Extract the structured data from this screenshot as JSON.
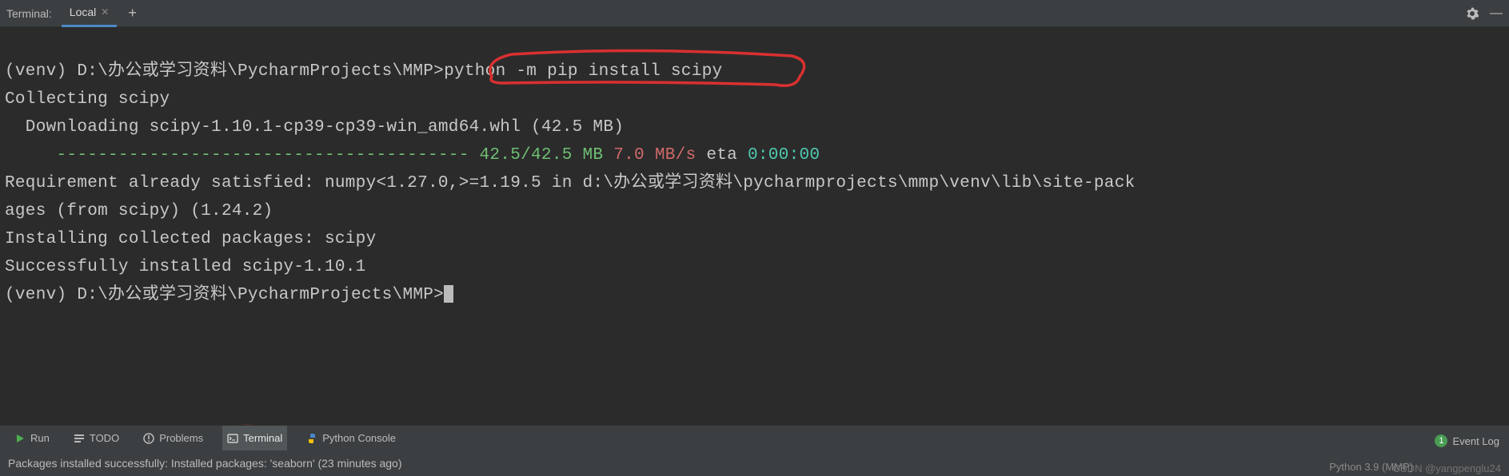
{
  "topbar": {
    "label": "Terminal:",
    "tab_name": "Local",
    "plus": "+"
  },
  "terminal": {
    "line1_prompt": "(venv) D:\\办公或学习资料\\PycharmProjects\\MMP>",
    "line1_cmd": "python -m pip install scipy",
    "line2": "Collecting scipy",
    "line3": "  Downloading scipy-1.10.1-cp39-cp39-win_amd64.whl (42.5 MB)",
    "line4_dashes": "     ---------------------------------------- ",
    "line4_prog": "42.5/42.5 MB",
    "line4_speed": " 7.0 MB/s",
    "line4_eta_lbl": " eta ",
    "line4_eta": "0:00:00",
    "line5": "Requirement already satisfied: numpy<1.27.0,>=1.19.5 in d:\\办公或学习资料\\pycharmprojects\\mmp\\venv\\lib\\site-pack",
    "line6": "ages (from scipy) (1.24.2)",
    "line7": "Installing collected packages: scipy",
    "line8": "Successfully installed scipy-1.10.1",
    "line_blank": "",
    "line9_prompt": "(venv) D:\\办公或学习资料\\PycharmProjects\\MMP>"
  },
  "toolbar": {
    "run": "Run",
    "todo": "TODO",
    "problems": "Problems",
    "terminal": "Terminal",
    "python_console": "Python Console",
    "event_log": "Event Log",
    "badge": "1"
  },
  "status": {
    "msg": "Packages installed successfully: Installed packages: 'seaborn' (23 minutes ago)",
    "python": "Python 3.9 (MMP)"
  },
  "watermark": "CSDN @yangpenglu24",
  "icons": {
    "gear": "gear-icon",
    "hide": "hide-icon",
    "close": "close-icon",
    "plus": "plus-icon",
    "run": "run-icon",
    "todo": "todo-icon",
    "problems": "problems-icon",
    "terminal": "terminal-icon",
    "python": "python-icon"
  }
}
